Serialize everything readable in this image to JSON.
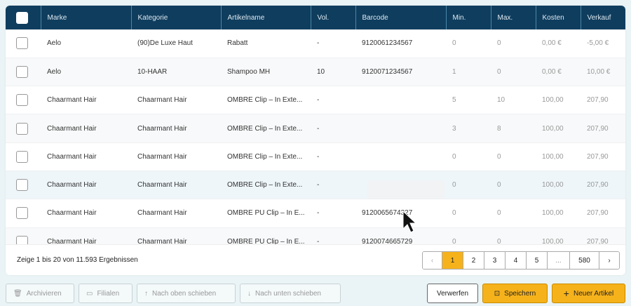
{
  "columns": [
    "Marke",
    "Kategorie",
    "Artikelname",
    "Vol.",
    "Barcode",
    "Min.",
    "Max.",
    "Kosten",
    "Verkauf"
  ],
  "rows": [
    [
      "Aelo",
      "(90)De Luxe Haut",
      "Rabatt",
      "-",
      "9120061234567",
      "0",
      "0",
      "0,00 €",
      "-5,00 €"
    ],
    [
      "Aelo",
      "10-HAAR",
      "Shampoo MH",
      "10",
      "9120071234567",
      "1",
      "0",
      "0,00 €",
      "10,00 €"
    ],
    [
      "Chaarmant Hair",
      "Chaarmant Hair",
      "OMBRE Clip – In Exte...",
      "-",
      "",
      "5",
      "10",
      "100,00",
      "207,90"
    ],
    [
      "Chaarmant Hair",
      "Chaarmant Hair",
      "OMBRE Clip – In Exte...",
      "-",
      "",
      "3",
      "8",
      "100,00",
      "207,90"
    ],
    [
      "Chaarmant Hair",
      "Chaarmant Hair",
      "OMBRE Clip – In Exte...",
      "-",
      "",
      "0",
      "0",
      "100,00",
      "207,90"
    ],
    [
      "Chaarmant Hair",
      "Chaarmant Hair",
      "OMBRE Clip – In Exte...",
      "-",
      "",
      "0",
      "0",
      "100,00",
      "207,90"
    ],
    [
      "Chaarmant Hair",
      "Chaarmant Hair",
      "OMBRE PU Clip – In E...",
      "-",
      "9120065674327",
      "0",
      "0",
      "100,00",
      "207,90"
    ],
    [
      "Chaarmant Hair",
      "Chaarmant Hair",
      "OMBRE PU Clip – In E...",
      "-",
      "9120074665729",
      "0",
      "0",
      "100,00",
      "207,90"
    ]
  ],
  "footer": {
    "count": "Zeige 1 bis 20 von 11.593 Ergebnissen",
    "pages": [
      "1",
      "2",
      "3",
      "4",
      "5",
      "...",
      "580"
    ],
    "prev": "‹",
    "next": "›"
  },
  "actions": {
    "archive": "Archivieren",
    "branches": "Filialen",
    "move_up": "Nach oben schieben",
    "move_down": "Nach unten schieben",
    "discard": "Verwerfen",
    "save": "Speichern",
    "new": "Neuer Artikel"
  },
  "colors": {
    "header": "#0f3d5e",
    "accent": "#f6b21b"
  }
}
